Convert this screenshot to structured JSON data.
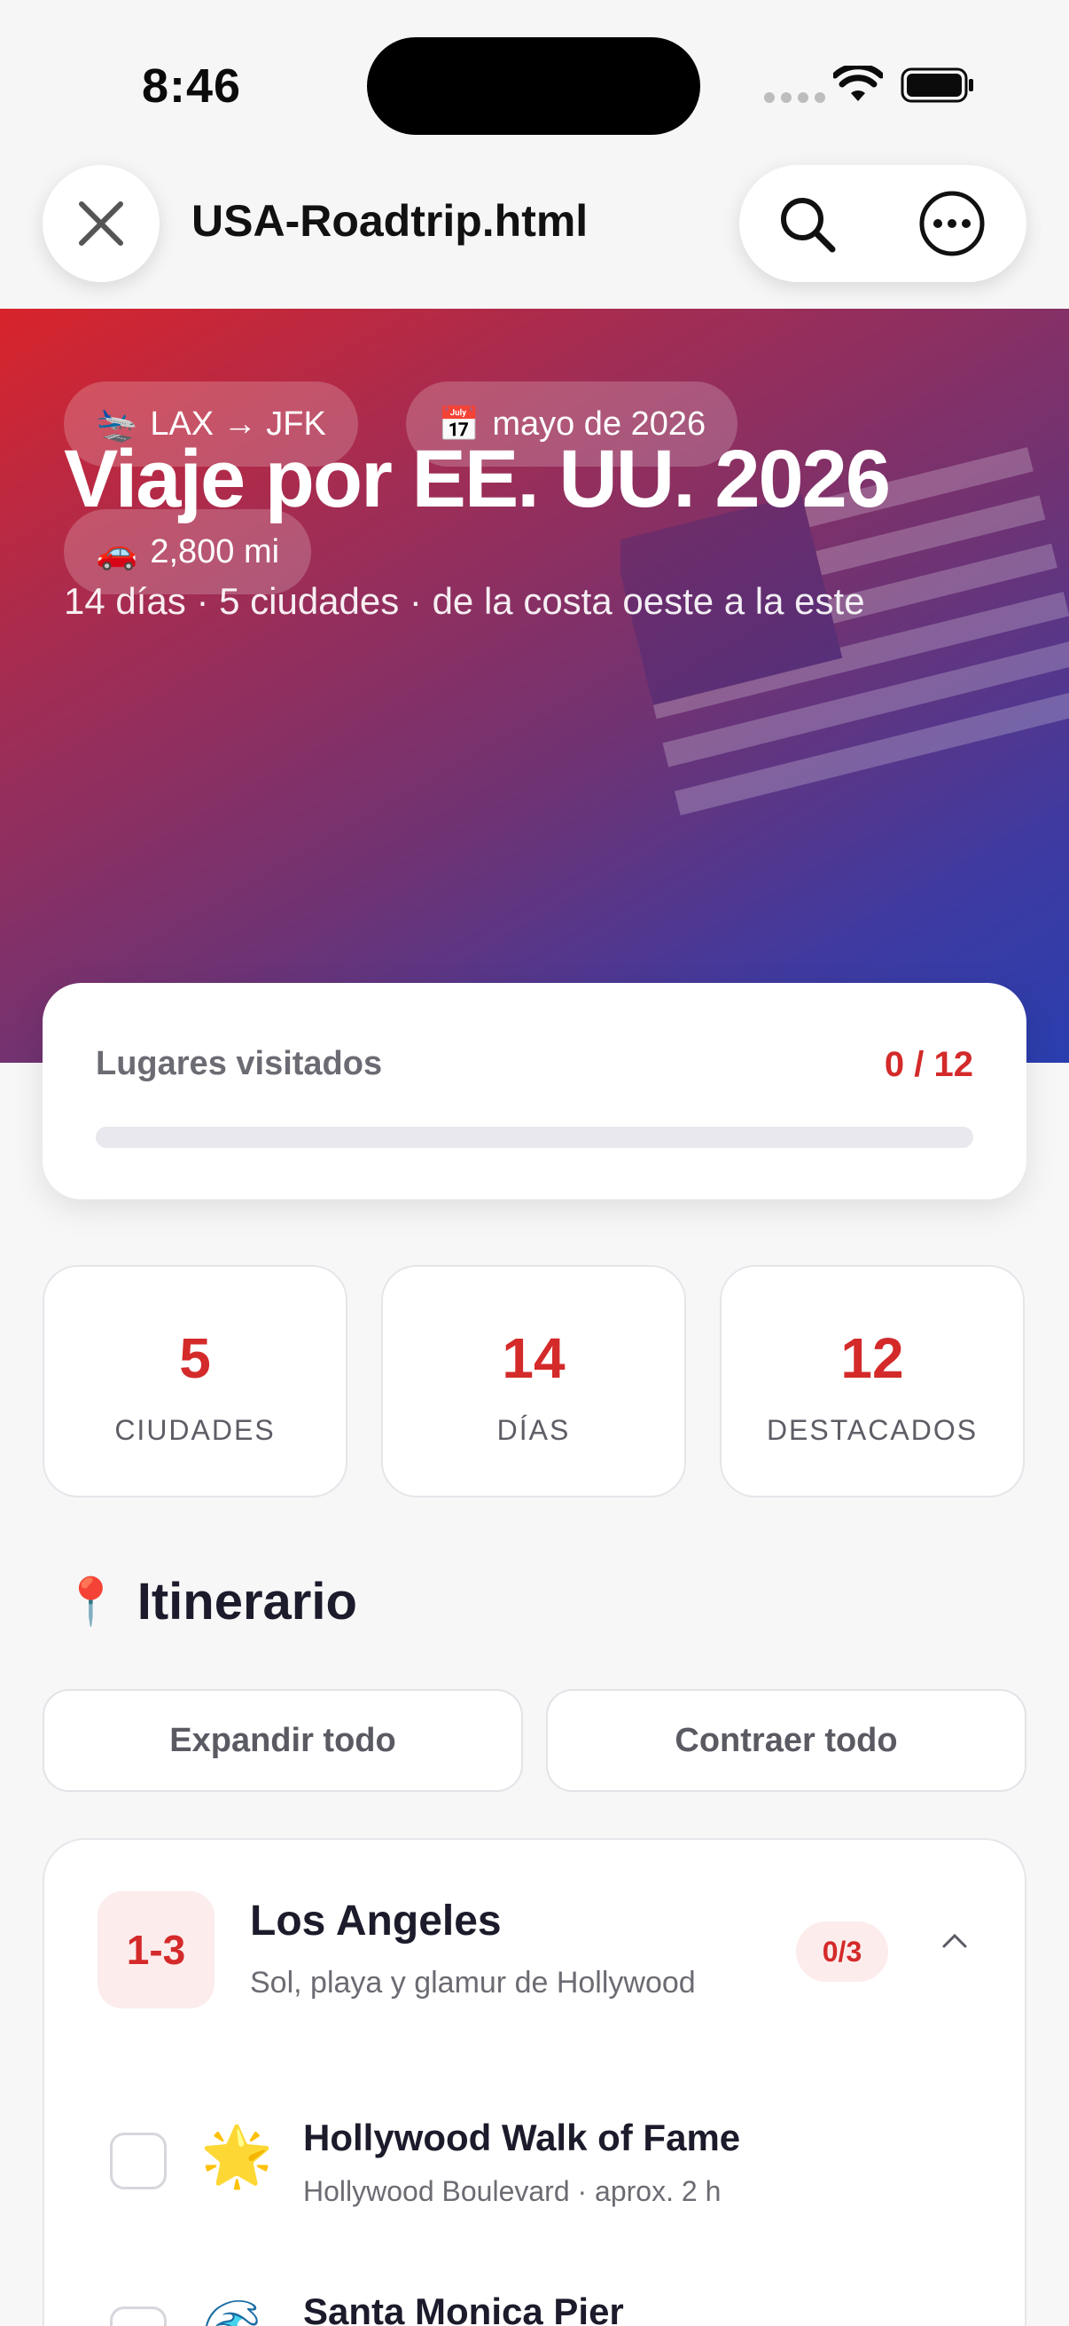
{
  "status_bar": {
    "time": "8:46"
  },
  "header": {
    "file_title": "USA-Roadtrip.html"
  },
  "hero": {
    "title": "Viaje por EE. UU. 2026",
    "subtitle": "14 días · 5 ciudades · de la costa oeste a la este",
    "chips": [
      {
        "emoji": "🛬",
        "label": "LAX → JFK"
      },
      {
        "emoji": "📅",
        "label": "mayo de 2026"
      },
      {
        "emoji": "🚗",
        "label": "2,800 mi"
      }
    ]
  },
  "progress": {
    "label": "Lugares visitados",
    "count_text": "0 / 12",
    "visited": 0,
    "total": 12
  },
  "stats": [
    {
      "value": "5",
      "label": "CIUDADES"
    },
    {
      "value": "14",
      "label": "DÍAS"
    },
    {
      "value": "12",
      "label": "DESTACADOS"
    }
  ],
  "itinerary": {
    "title": "Itinerario",
    "expand_label": "Expandir todo",
    "collapse_label": "Contraer todo",
    "cities": [
      {
        "days": "1-3",
        "name": "Los Angeles",
        "tagline": "Sol, playa y glamur de Hollywood",
        "count": "0/3",
        "places": [
          {
            "emoji": "🌟",
            "name": "Hollywood Walk of Fame",
            "detail": "Hollywood Boulevard · aprox. 2 h"
          },
          {
            "emoji": "🌊",
            "name": "Santa Monica Pier",
            "detail": ""
          }
        ]
      }
    ]
  },
  "colors": {
    "accent": "#d42a2a",
    "hero_start": "#d8242b",
    "hero_end": "#2a3eae"
  }
}
